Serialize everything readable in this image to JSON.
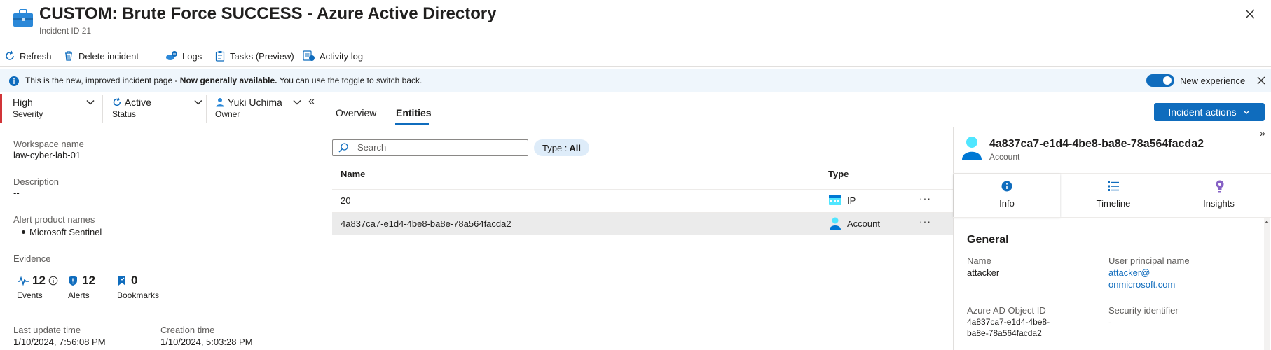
{
  "header": {
    "title": "CUSTOM: Brute Force SUCCESS - Azure Active Directory",
    "incident_id": "Incident ID 21",
    "more": "···",
    "icon": "briefcase-icon"
  },
  "toolbar": {
    "refresh": "Refresh",
    "delete": "Delete incident",
    "logs": "Logs",
    "tasks": "Tasks (Preview)",
    "activity": "Activity log"
  },
  "banner": {
    "text_start": "This is the new, improved incident page - ",
    "text_bold": "Now generally available.",
    "text_end": " You can use the toggle to switch back.",
    "toggle_label": "New experience",
    "toggle_on": true
  },
  "left": {
    "severity": {
      "value": "High",
      "label": "Severity"
    },
    "status": {
      "value": "Active",
      "label": "Status"
    },
    "owner": {
      "value": "Yuki Uchima",
      "label": "Owner"
    },
    "collapse": "«",
    "workspace": {
      "label": "Workspace name",
      "value": "law-cyber-lab-01"
    },
    "description": {
      "label": "Description",
      "value": "--"
    },
    "alert_products": {
      "label": "Alert product names",
      "items": [
        "Microsoft Sentinel"
      ]
    },
    "evidence": {
      "label": "Evidence",
      "events": {
        "count": "12",
        "label": "Events"
      },
      "alerts": {
        "count": "12",
        "label": "Alerts"
      },
      "bookmarks": {
        "count": "0",
        "label": "Bookmarks"
      }
    },
    "last_update": {
      "label": "Last update time",
      "value": "1/10/2024, 7:56:08 PM"
    },
    "creation": {
      "label": "Creation time",
      "value": "1/10/2024, 5:03:28 PM"
    }
  },
  "center": {
    "tabs": [
      {
        "label": "Overview",
        "active": false
      },
      {
        "label": "Entities",
        "active": true
      }
    ],
    "search_placeholder": "Search",
    "type_filter_prefix": "Type : ",
    "type_filter_value": "All",
    "columns": {
      "name": "Name",
      "type": "Type"
    },
    "rows": [
      {
        "name": "20",
        "type": "IP",
        "icon": "ip-icon",
        "selected": false
      },
      {
        "name": "4a837ca7-e1d4-4be8-ba8e-78a564facda2",
        "type": "Account",
        "icon": "account-icon",
        "selected": true
      }
    ],
    "row_more": "···"
  },
  "incident_actions": "Incident actions",
  "entity_panel": {
    "title": "4a837ca7-e1d4-4be8-ba8e-78a564facda2",
    "subtitle": "Account",
    "expand": "»",
    "tabs": [
      {
        "label": "Info",
        "icon": "info-icon",
        "active": true
      },
      {
        "label": "Timeline",
        "icon": "timeline-icon",
        "active": false
      },
      {
        "label": "Insights",
        "icon": "insights-icon",
        "active": false
      }
    ],
    "section": "General",
    "fields": {
      "name": {
        "label": "Name",
        "value": "attacker"
      },
      "upn": {
        "label": "User principal name",
        "value_line1": "attacker@",
        "value_line2": "onmicrosoft.com"
      },
      "aad_id": {
        "label": "Azure AD Object ID",
        "value_line1": "4a837ca7-e1d4-4be8-",
        "value_line2": "ba8e-78a564facda2"
      },
      "sid": {
        "label": "Security identifier",
        "value": "-"
      }
    }
  },
  "colors": {
    "accent": "#0f6cbd",
    "severity_high": "#d13438",
    "banner_bg": "#eff6fc",
    "selected_row": "#ebebeb"
  }
}
